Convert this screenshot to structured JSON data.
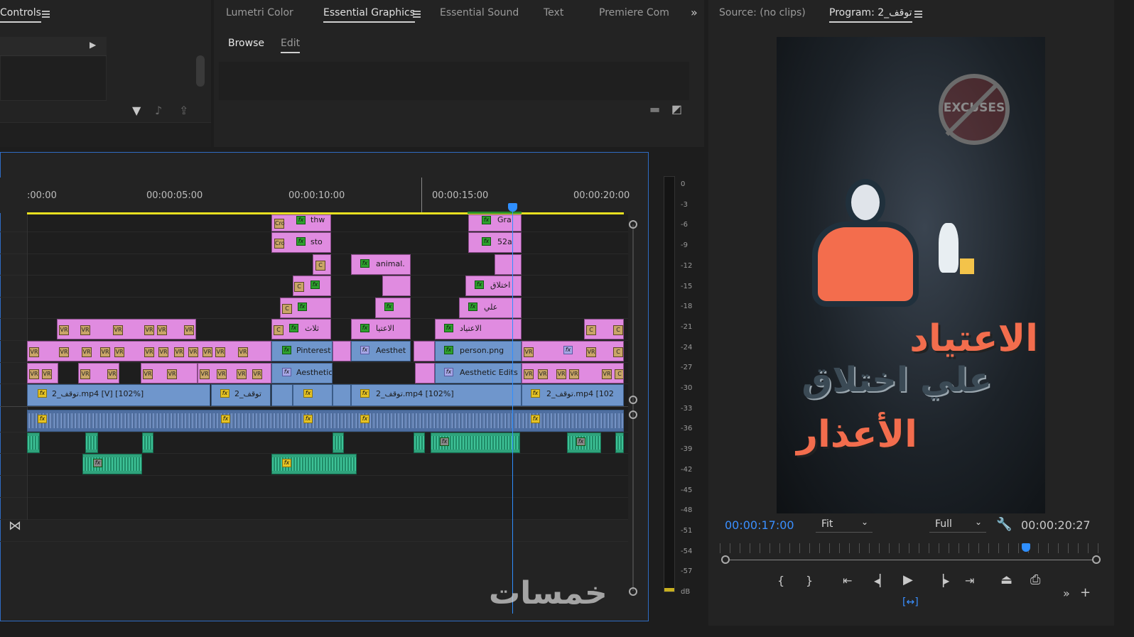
{
  "top_left_panel": {
    "title": "Controls"
  },
  "graphics_panel": {
    "tabs": [
      "Lumetri Color",
      "Essential Graphics",
      "Essential Sound",
      "Text",
      "Premiere Compo"
    ],
    "subtabs": [
      "Browse",
      "Edit"
    ]
  },
  "monitor": {
    "source_tab": "Source: (no clips)",
    "program_tab": "Program: توقف_2",
    "current_time": "00:00:17:00",
    "duration": "00:00:20:27",
    "zoom": "Fit",
    "resolution": "Full",
    "video_text": {
      "line1": "الاعتياد",
      "line2": "علي اختلاق",
      "line3": "الأعذار",
      "badge": "EXCUSES"
    }
  },
  "timeline": {
    "timecodes": [
      ":00:00",
      "00:00:05:00",
      "00:00:10:00",
      "00:00:15:00",
      "00:00:20:00"
    ],
    "clips": {
      "v5a": "thw",
      "v5b": "Gra",
      "v4a": "sto",
      "v4b": "52a",
      "v3a": "animal.",
      "v2a": "اختلاق",
      "v1a": "علي",
      "v0a": "ثلاث",
      "v0b": "الاعتيا",
      "v0c": "الاعتياد",
      "p1": "Pinterest",
      "p2": "Aesthet",
      "p3": "person.png",
      "a1": "Aesthetic",
      "a2": "Aesthetic Edits",
      "m1": "توقف_2.mp4 [V] [102%]",
      "m2": "توقف_2",
      "m3": "توقف_2.mp4 [102%]",
      "m4": "توقف_2.mp4 [102",
      "cr": "Cro",
      "vr": "VR",
      "c": "C"
    }
  },
  "audio_meter": {
    "labels": [
      "0",
      "-3",
      "-6",
      "-9",
      "-12",
      "-15",
      "-18",
      "-21",
      "-24",
      "-27",
      "-30",
      "-33",
      "-36",
      "-39",
      "-42",
      "-45",
      "-48",
      "-51",
      "-54",
      "-57",
      "dB"
    ]
  },
  "watermark": "خمسات",
  "colors": {
    "accent": "#2f8fff",
    "playhead": "#2f8fff",
    "clip_pink": "#e08be0",
    "clip_blue": "#6f96cc",
    "clip_green": "#2fa37c",
    "timecode_blue": "#3a8fff"
  }
}
